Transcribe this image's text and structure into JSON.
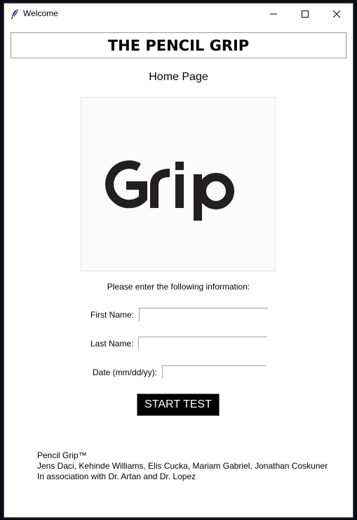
{
  "window": {
    "title": "Welcome",
    "icon": "feather-icon",
    "controls": [
      "minimize-icon",
      "maximize-icon",
      "close-icon"
    ]
  },
  "header": {
    "title": "THE PENCIL GRIP"
  },
  "page": {
    "subtitle": "Home Page",
    "logo_text": "Grip",
    "prompt": "Please enter the following information:"
  },
  "form": {
    "first_name_label": "First Name:",
    "first_name_value": "",
    "last_name_label": "Last Name:",
    "last_name_value": "",
    "date_label": "Date (mm/dd/yy):",
    "date_value": ""
  },
  "actions": {
    "start_label": "START TEST"
  },
  "footer": {
    "line1": "Pencil Grip™",
    "line2": "Jens Daci, Kehinde Williams, Elis Cucka, Mariam Gabriel, Jonathan Coskuner",
    "line3": "In association with Dr. Artan and Dr. Lopez"
  },
  "colors": {
    "logo": "#231f20",
    "button_bg": "#000000",
    "button_text": "#ffffff"
  }
}
